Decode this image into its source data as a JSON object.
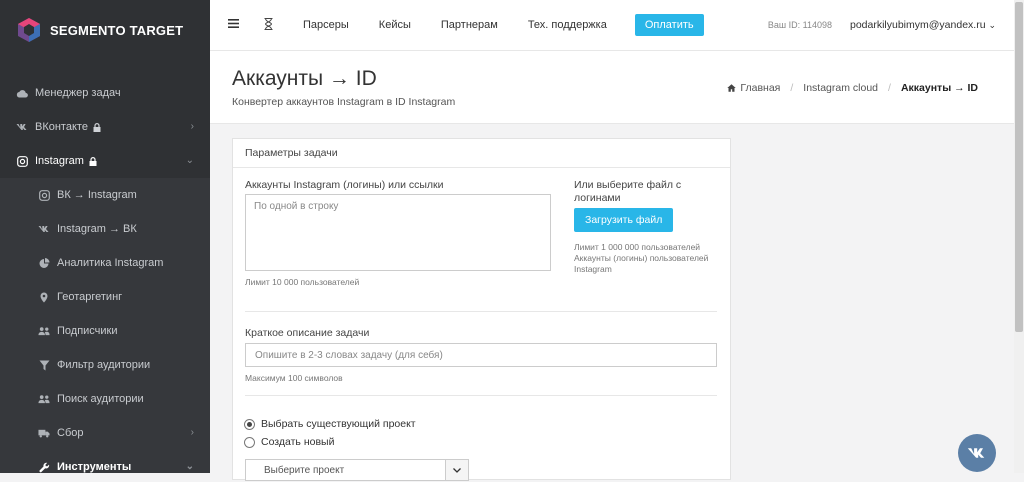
{
  "brand": {
    "name": "SEGMENTO TARGET"
  },
  "sidebar": {
    "items": [
      {
        "label": "Менеджер задач",
        "icon": "cloud-icon"
      },
      {
        "label": "ВКонтакте",
        "icon": "vk-icon"
      },
      {
        "label": "Instagram",
        "icon": "instagram-icon"
      },
      {
        "label": "ВК → Instagram",
        "icon": "instagram-icon"
      },
      {
        "label": "Instagram → ВК",
        "icon": "vk-icon"
      },
      {
        "label": "Аналитика Instagram",
        "icon": "pie-chart-icon"
      },
      {
        "label": "Геотаргетинг",
        "icon": "map-marker-icon"
      },
      {
        "label": "Подписчики",
        "icon": "users-icon"
      },
      {
        "label": "Фильтр аудитории",
        "icon": "filter-icon"
      },
      {
        "label": "Поиск аудитории",
        "icon": "users-icon"
      },
      {
        "label": "Сбор",
        "icon": "truck-icon"
      },
      {
        "label": "Инструменты",
        "icon": "wrench-icon"
      }
    ]
  },
  "topbar": {
    "menu": [
      "Парсеры",
      "Кейсы",
      "Партнерам",
      "Тех. поддержка"
    ],
    "pay_label": "Оплатить",
    "user_id": "Ваш ID: 114098",
    "user_email": "podarkilyubimym@yandex.ru"
  },
  "page": {
    "title": "Аккаунты → ID",
    "subtitle": "Конвертер аккаунтов Instagram в ID Instagram",
    "breadcrumb": [
      "Главная",
      "Instagram cloud",
      "Аккаунты → ID"
    ]
  },
  "form": {
    "card_title": "Параметры задачи",
    "accounts_label": "Аккаунты Instagram (логины) или ссылки",
    "accounts_placeholder": "По одной в строку",
    "accounts_hint": "Лимит 10 000 пользователей",
    "file_label": "Или выберите файл с логинами",
    "upload_label": "Загрузить файл",
    "file_hint": "Лимит 1 000 000 пользователей Аккаунты (логины) пользователей Instagram",
    "desc_label": "Краткое описание задачи",
    "desc_placeholder": "Опишите в 2-3 словах задачу (для себя)",
    "desc_hint": "Максимум 100 символов",
    "radio_existing": "Выбрать существующий проект",
    "radio_new": "Создать новый",
    "select_value": "Выберите проект"
  },
  "colors": {
    "accent": "#29b6e8",
    "sidebar_bg": "#2f3134",
    "vk": "#5b7fa6"
  }
}
